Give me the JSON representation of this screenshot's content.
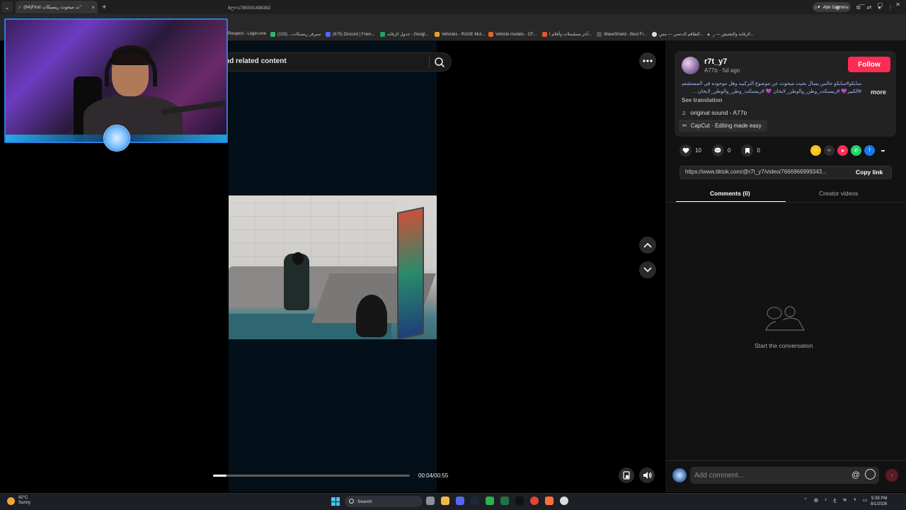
{
  "browser": {
    "tab_title": "(64)Find ت مبحوث ريسبكات\"",
    "tab_close": "×",
    "new_tab": "+",
    "ask_gemini": "Ask Gemini",
    "window_controls": [
      "—",
      "▢",
      "✕"
    ],
    "url": "ح8t=1785591498382"
  },
  "bookmarks": [
    {
      "label": "Respect - Login-one",
      "color": "#444"
    },
    {
      "label": "سيرفر ريسبكات... (103)",
      "color": "#2bb673"
    },
    {
      "label": "(875) Discord | Frien...",
      "color": "#5865f2"
    },
    {
      "label": "جدول الرقابه - Googl...",
      "color": "#1fa463"
    },
    {
      "label": "Vehicles - RAGE Mul...",
      "color": "#e6a12a"
    },
    {
      "label": "Vehicle models - CF...",
      "color": "#e0672c"
    },
    {
      "label": "آخر مسلسلات وأفلام ا...",
      "color": "#e8542b"
    },
    {
      "label": "WaveShield - Best Fi...",
      "color": "#333"
    },
    {
      "label": "الطاقم الدعمي — مس...",
      "color": "#ddd"
    },
    {
      "label": "الرقابة والتفتيش — ر...",
      "color": "#111"
    }
  ],
  "search": {
    "text": "nd related content"
  },
  "video": {
    "current_time": "00:04",
    "duration": "00:55",
    "time_label": "00:04/00:55",
    "progress": 0.07
  },
  "post": {
    "username": "r7t_y7",
    "subline": "A77ᴅ · 5d ago",
    "follow_label": "Follow",
    "caption_line1": "سايكو#سايكو جالس يسأل بخيت مبحوث عن موضوع التركيبه وهل موجوده في المستشفى",
    "caption_line2": "#الكبير💜 #ريسبكت_وطن_والوطن_لايخان 💜 #ريسبكت_وطن_والوطن_لايخان ...",
    "more_label": "more",
    "see_translation": "See translation",
    "sound": "original sound - A77ᴅ",
    "capcut": "CapCut · Editing made easy",
    "likes": "10",
    "comments": "0",
    "saves": "0",
    "link": "https://www.tiktok.com/@r7t_y7/video/7666966999343...",
    "copy_link": "Copy link"
  },
  "tabs": {
    "comments": "Comments (0)",
    "creator_videos": "Creator videos"
  },
  "empty_state": "Start the conversation",
  "comment_placeholder": "Add comment...",
  "taskbar": {
    "temp": "42°C",
    "weather": "Sunny",
    "search": "Search",
    "time": "5:39 PM",
    "date": "8/1/2026",
    "lang": "ع"
  },
  "colors": {
    "follow": "#fe2c55",
    "webcam_border": "#2a7de1"
  }
}
